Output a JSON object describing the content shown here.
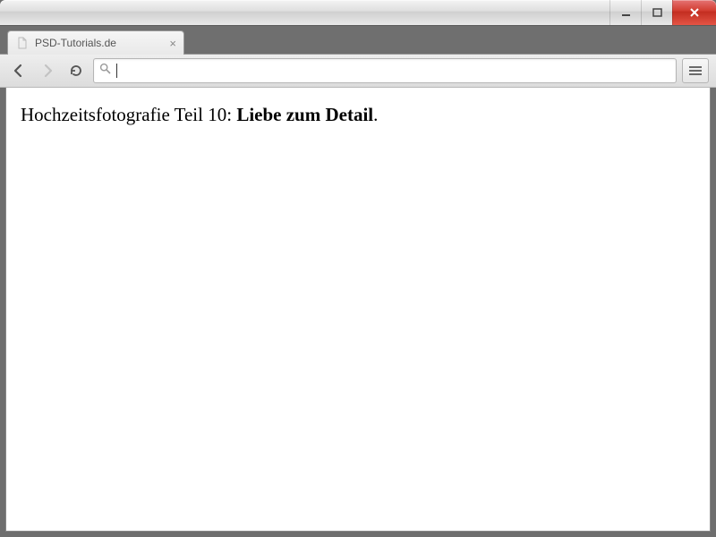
{
  "tab": {
    "title": "PSD-Tutorials.de"
  },
  "address": {
    "value": ""
  },
  "content": {
    "prefix": "Hochzeitsfotografie Teil 10: ",
    "emphasis": "Liebe zum Detail",
    "suffix": "."
  }
}
